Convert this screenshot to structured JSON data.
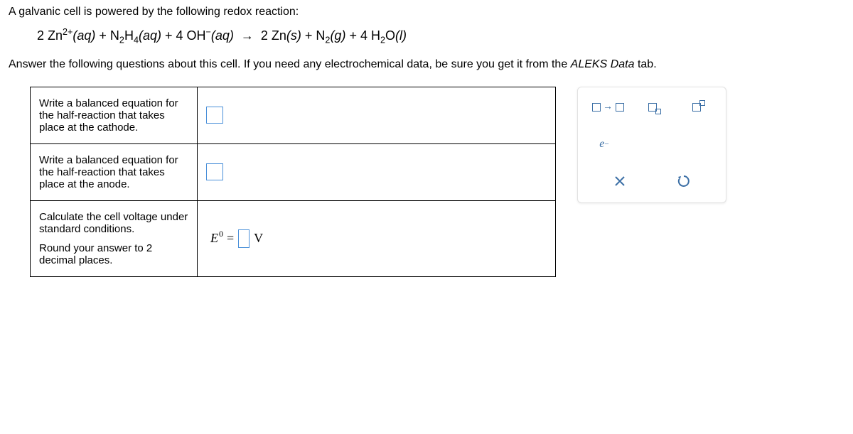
{
  "intro": "A galvanic cell is powered by the following redox reaction:",
  "equation": {
    "lhs": "2 Zn²⁺(aq) + N₂H₄(aq) + 4 OH⁻(aq)",
    "arrow": "→",
    "rhs": "2 Zn(s) + N₂(g) + 4 H₂O(l)"
  },
  "instruction_prefix": "Answer the following questions about this cell. If you need any electrochemical data, be sure you get it from the ",
  "instruction_emph": "ALEKS Data",
  "instruction_suffix": " tab.",
  "rows": {
    "cathode": "Write a balanced equation for the half-reaction that takes place at the cathode.",
    "anode": "Write a balanced equation for the half-reaction that takes place at the anode.",
    "voltage_a": "Calculate the cell voltage under standard conditions.",
    "voltage_b": "Round your answer to 2 decimal places.",
    "e_label": "E",
    "e_sup": "0",
    "eq": "=",
    "unit": "V"
  },
  "palette": {
    "electron": "e",
    "electron_sup": "−",
    "clear": "×",
    "reset": "↺"
  }
}
